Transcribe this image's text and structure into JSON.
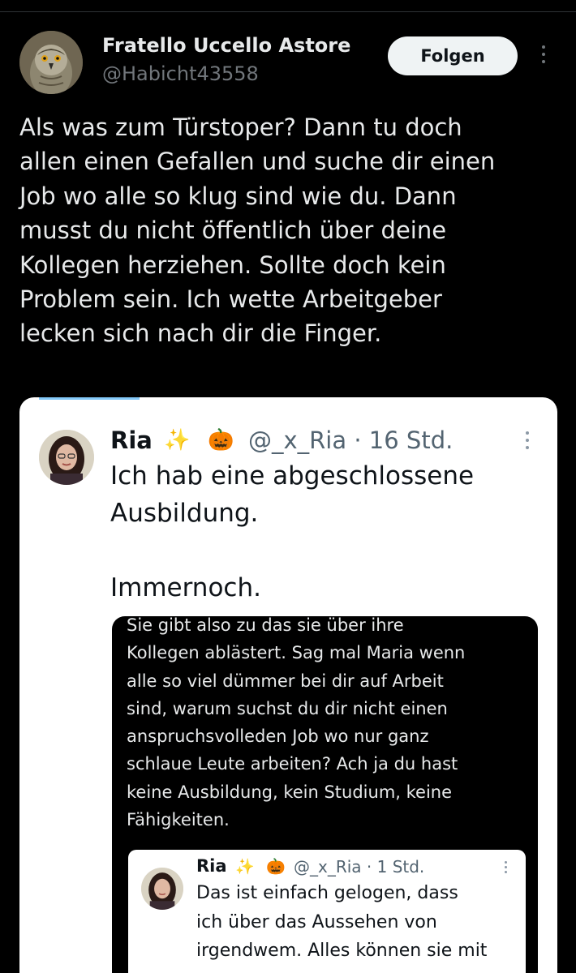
{
  "author": {
    "display_name": "Fratello Uccello Astore",
    "handle": "@Habicht43558",
    "avatar_icon": "hawk-avatar"
  },
  "actions": {
    "follow_label": "Folgen",
    "more_icon": "more-vertical-icon"
  },
  "tweet": {
    "lines": [
      "Als was zum Türstoper? Dann tu doch",
      "allen einen Gefallen und suche dir einen",
      "Job wo alle so klug sind wie du. Dann",
      "musst du nicht öffentlich über deine",
      "Kollegen herziehen. Sollte doch kein",
      "Problem sein. Ich wette Arbeitgeber",
      "lecken sich nach dir die Finger."
    ]
  },
  "screenshot": {
    "ria": {
      "name": "Ria",
      "emoji_sparkles": "✨",
      "emoji_pumpkin": "🎃",
      "handle_time": "@_x_Ria · 16 Std.",
      "lines": [
        "Ich hab eine abgeschlossene",
        "Ausbildung.",
        "",
        "Immernoch."
      ]
    },
    "dark_quote": {
      "lines": [
        "Sie gibt also zu das sie über ihre",
        "Kollegen ablästert. Sag mal Maria wenn",
        "alle so viel dümmer bei dir auf Arbeit",
        "sind, warum suchst du dir nicht einen",
        "anspruchsvolleden Job wo nur ganz",
        "schlaue Leute arbeiten? Ach ja du hast",
        "keine Ausbildung, kein Studium, keine",
        "Fähigkeiten."
      ]
    },
    "inner_quote": {
      "name": "Ria",
      "emoji_sparkles": "✨",
      "emoji_pumpkin": "🎃",
      "handle_time": "@_x_Ria · 1 Std.",
      "lines": [
        "Das ist einfach gelogen, dass",
        "ich über das Aussehen von",
        "irgendwem. Alles können sie mit"
      ]
    }
  },
  "colors": {
    "background": "#000000",
    "text_primary": "#e7e9ea",
    "text_secondary": "#71767b",
    "follow_bg": "#eff3f4",
    "accent": "#1d9bf0"
  }
}
